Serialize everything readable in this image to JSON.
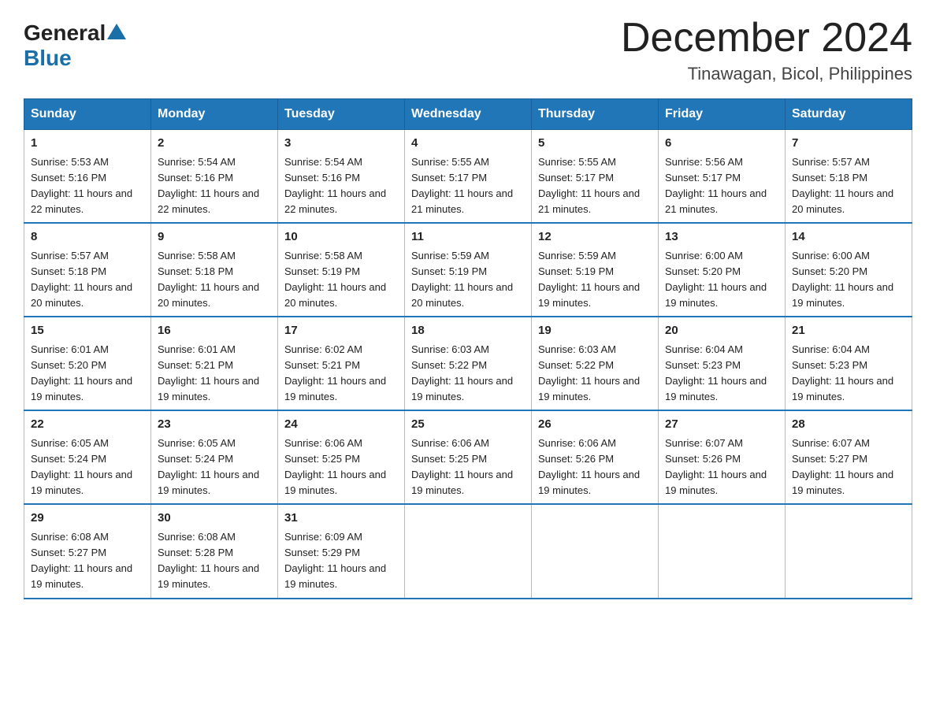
{
  "logo": {
    "general": "General",
    "blue": "Blue"
  },
  "title": "December 2024",
  "location": "Tinawagan, Bicol, Philippines",
  "days_of_week": [
    "Sunday",
    "Monday",
    "Tuesday",
    "Wednesday",
    "Thursday",
    "Friday",
    "Saturday"
  ],
  "weeks": [
    [
      {
        "day": "1",
        "sunrise": "5:53 AM",
        "sunset": "5:16 PM",
        "daylight": "11 hours and 22 minutes."
      },
      {
        "day": "2",
        "sunrise": "5:54 AM",
        "sunset": "5:16 PM",
        "daylight": "11 hours and 22 minutes."
      },
      {
        "day": "3",
        "sunrise": "5:54 AM",
        "sunset": "5:16 PM",
        "daylight": "11 hours and 22 minutes."
      },
      {
        "day": "4",
        "sunrise": "5:55 AM",
        "sunset": "5:17 PM",
        "daylight": "11 hours and 21 minutes."
      },
      {
        "day": "5",
        "sunrise": "5:55 AM",
        "sunset": "5:17 PM",
        "daylight": "11 hours and 21 minutes."
      },
      {
        "day": "6",
        "sunrise": "5:56 AM",
        "sunset": "5:17 PM",
        "daylight": "11 hours and 21 minutes."
      },
      {
        "day": "7",
        "sunrise": "5:57 AM",
        "sunset": "5:18 PM",
        "daylight": "11 hours and 20 minutes."
      }
    ],
    [
      {
        "day": "8",
        "sunrise": "5:57 AM",
        "sunset": "5:18 PM",
        "daylight": "11 hours and 20 minutes."
      },
      {
        "day": "9",
        "sunrise": "5:58 AM",
        "sunset": "5:18 PM",
        "daylight": "11 hours and 20 minutes."
      },
      {
        "day": "10",
        "sunrise": "5:58 AM",
        "sunset": "5:19 PM",
        "daylight": "11 hours and 20 minutes."
      },
      {
        "day": "11",
        "sunrise": "5:59 AM",
        "sunset": "5:19 PM",
        "daylight": "11 hours and 20 minutes."
      },
      {
        "day": "12",
        "sunrise": "5:59 AM",
        "sunset": "5:19 PM",
        "daylight": "11 hours and 19 minutes."
      },
      {
        "day": "13",
        "sunrise": "6:00 AM",
        "sunset": "5:20 PM",
        "daylight": "11 hours and 19 minutes."
      },
      {
        "day": "14",
        "sunrise": "6:00 AM",
        "sunset": "5:20 PM",
        "daylight": "11 hours and 19 minutes."
      }
    ],
    [
      {
        "day": "15",
        "sunrise": "6:01 AM",
        "sunset": "5:20 PM",
        "daylight": "11 hours and 19 minutes."
      },
      {
        "day": "16",
        "sunrise": "6:01 AM",
        "sunset": "5:21 PM",
        "daylight": "11 hours and 19 minutes."
      },
      {
        "day": "17",
        "sunrise": "6:02 AM",
        "sunset": "5:21 PM",
        "daylight": "11 hours and 19 minutes."
      },
      {
        "day": "18",
        "sunrise": "6:03 AM",
        "sunset": "5:22 PM",
        "daylight": "11 hours and 19 minutes."
      },
      {
        "day": "19",
        "sunrise": "6:03 AM",
        "sunset": "5:22 PM",
        "daylight": "11 hours and 19 minutes."
      },
      {
        "day": "20",
        "sunrise": "6:04 AM",
        "sunset": "5:23 PM",
        "daylight": "11 hours and 19 minutes."
      },
      {
        "day": "21",
        "sunrise": "6:04 AM",
        "sunset": "5:23 PM",
        "daylight": "11 hours and 19 minutes."
      }
    ],
    [
      {
        "day": "22",
        "sunrise": "6:05 AM",
        "sunset": "5:24 PM",
        "daylight": "11 hours and 19 minutes."
      },
      {
        "day": "23",
        "sunrise": "6:05 AM",
        "sunset": "5:24 PM",
        "daylight": "11 hours and 19 minutes."
      },
      {
        "day": "24",
        "sunrise": "6:06 AM",
        "sunset": "5:25 PM",
        "daylight": "11 hours and 19 minutes."
      },
      {
        "day": "25",
        "sunrise": "6:06 AM",
        "sunset": "5:25 PM",
        "daylight": "11 hours and 19 minutes."
      },
      {
        "day": "26",
        "sunrise": "6:06 AM",
        "sunset": "5:26 PM",
        "daylight": "11 hours and 19 minutes."
      },
      {
        "day": "27",
        "sunrise": "6:07 AM",
        "sunset": "5:26 PM",
        "daylight": "11 hours and 19 minutes."
      },
      {
        "day": "28",
        "sunrise": "6:07 AM",
        "sunset": "5:27 PM",
        "daylight": "11 hours and 19 minutes."
      }
    ],
    [
      {
        "day": "29",
        "sunrise": "6:08 AM",
        "sunset": "5:27 PM",
        "daylight": "11 hours and 19 minutes."
      },
      {
        "day": "30",
        "sunrise": "6:08 AM",
        "sunset": "5:28 PM",
        "daylight": "11 hours and 19 minutes."
      },
      {
        "day": "31",
        "sunrise": "6:09 AM",
        "sunset": "5:29 PM",
        "daylight": "11 hours and 19 minutes."
      },
      null,
      null,
      null,
      null
    ]
  ]
}
